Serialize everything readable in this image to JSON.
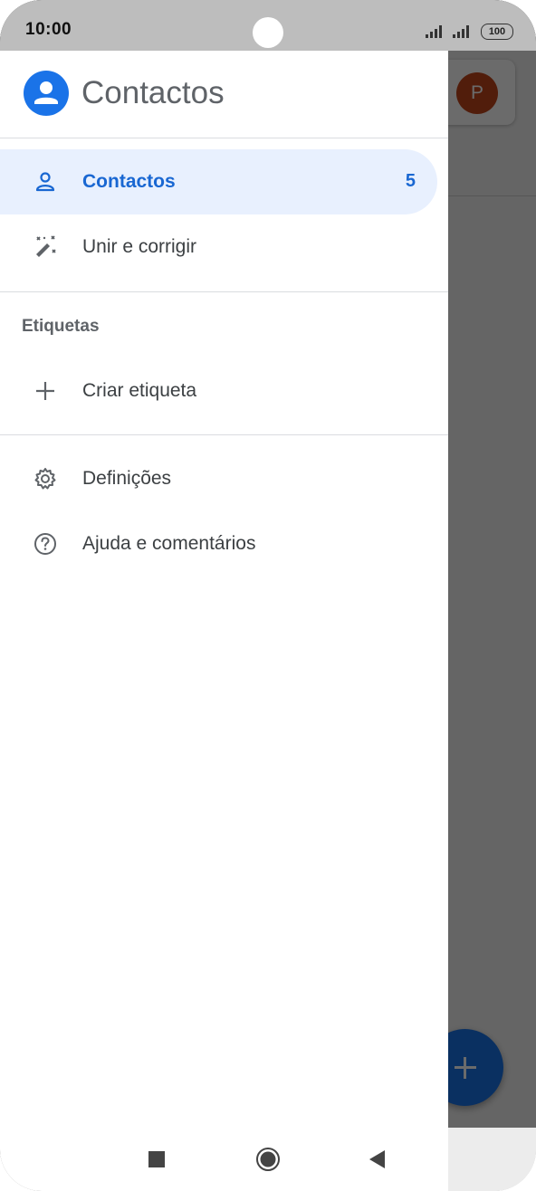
{
  "status_bar": {
    "time": "10:00",
    "battery": "100"
  },
  "drawer": {
    "title": "Contactos",
    "items": [
      {
        "label": "Contactos",
        "count": "5",
        "icon": "person-outline-icon",
        "active": true
      },
      {
        "label": "Unir e corrigir",
        "icon": "magic-wand-icon",
        "active": false
      }
    ],
    "labels_section": {
      "title": "Etiquetas",
      "create_label": "Criar etiqueta"
    },
    "settings_items": [
      {
        "label": "Definições",
        "icon": "gear-icon"
      },
      {
        "label": "Ajuda e comentários",
        "icon": "help-circle-icon"
      }
    ]
  },
  "background": {
    "avatar_letter": "P"
  },
  "colors": {
    "accent": "#1a73e8",
    "active_bg": "#e8f0fe",
    "avatar": "#c0451c"
  }
}
